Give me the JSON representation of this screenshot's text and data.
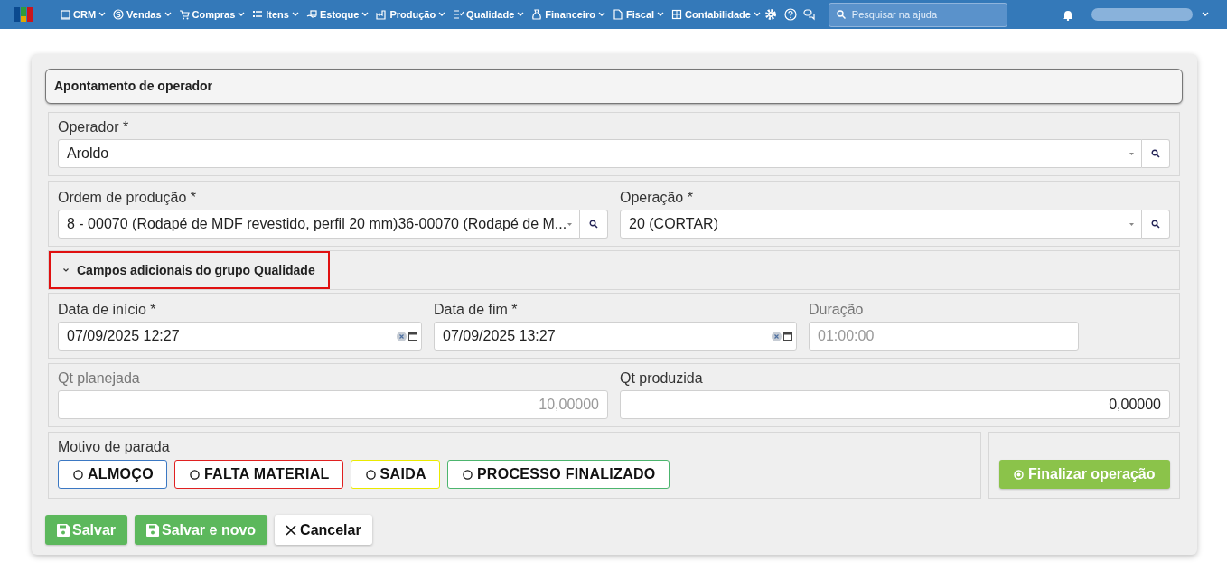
{
  "navbar": {
    "menus": [
      {
        "label": "CRM"
      },
      {
        "label": "Vendas"
      },
      {
        "label": "Compras"
      },
      {
        "label": "Itens"
      },
      {
        "label": "Estoque"
      },
      {
        "label": "Produção"
      },
      {
        "label": "Qualidade"
      },
      {
        "label": "Financeiro"
      },
      {
        "label": "Fiscal"
      },
      {
        "label": "Contabilidade"
      }
    ],
    "search": {
      "placeholder": "Pesquisar na ajuda"
    }
  },
  "panel": {
    "title": "Apontamento de operador"
  },
  "operador": {
    "label": "Operador *",
    "value": "Aroldo"
  },
  "ordem": {
    "label": "Ordem de produção *",
    "value": "8 - 00070 (Rodapé de MDF revestido, perfil 20 mm)36-00070 (Rodapé de M..."
  },
  "operacao": {
    "label": "Operação *",
    "value": "20 (CORTAR)"
  },
  "section_toggle": {
    "label": "Campos adicionais do grupo Qualidade",
    "expanded": true,
    "highlighted": true
  },
  "data_inicio": {
    "label": "Data de início *",
    "value": "07/09/2025 12:27"
  },
  "data_fim": {
    "label": "Data de fim *",
    "value": "07/09/2025 13:27"
  },
  "duracao": {
    "label": "Duração",
    "value": "01:00:00",
    "disabled": true
  },
  "qt_planejada": {
    "label": "Qt planejada",
    "value": "10,00000",
    "disabled": true
  },
  "qt_produzida": {
    "label": "Qt produzida",
    "value": "0,00000",
    "disabled": false
  },
  "motivo": {
    "label": "Motivo de parada",
    "options": [
      {
        "label": "ALMOÇO",
        "color": "#3b78c3",
        "selected": false
      },
      {
        "label": "FALTA MATERIAL",
        "color": "#e02020",
        "selected": false
      },
      {
        "label": "SAIDA",
        "color": "#eaea00",
        "selected": false
      },
      {
        "label": "PROCESSO FINALIZADO",
        "color": "#4cb56e",
        "selected": false
      }
    ]
  },
  "finalizar": {
    "label": "Finalizar operação"
  },
  "buttons": [
    {
      "label": "Salvar",
      "kind": "save"
    },
    {
      "label": "Salvar e novo",
      "kind": "save"
    },
    {
      "label": "Cancelar",
      "kind": "cancel"
    }
  ]
}
